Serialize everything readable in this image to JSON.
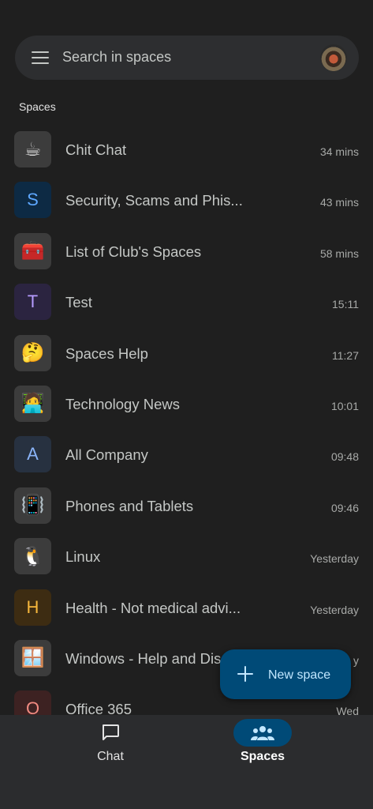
{
  "search": {
    "placeholder": "Search in spaces"
  },
  "section_label": "Spaces",
  "spaces": [
    {
      "title": "Chit Chat",
      "time": "34 mins",
      "icon_type": "emoji",
      "icon": "☕",
      "icon_name": "coffee-icon"
    },
    {
      "title": "Security, Scams and Phis...",
      "time": "43 mins",
      "icon_type": "letter",
      "icon": "S",
      "bg": "#0d2a44",
      "fg": "#5ea8ff"
    },
    {
      "title": "List of Club's Spaces",
      "time": "58 mins",
      "icon_type": "emoji",
      "icon": "🧰",
      "icon_name": "toolbox-icon"
    },
    {
      "title": "Test",
      "time": "15:11",
      "icon_type": "letter",
      "icon": "T",
      "bg": "#2b2440",
      "fg": "#b69cff"
    },
    {
      "title": "Spaces Help",
      "time": "11:27",
      "icon_type": "emoji",
      "icon": "🤔",
      "icon_name": "thinking-face-icon"
    },
    {
      "title": "Technology News",
      "time": "10:01",
      "icon_type": "emoji",
      "icon": "🧑‍💻",
      "icon_name": "technologist-icon"
    },
    {
      "title": "All Company",
      "time": "09:48",
      "icon_type": "letter",
      "icon": "A",
      "bg": "#273140",
      "fg": "#8ab4f8"
    },
    {
      "title": "Phones and Tablets",
      "time": "09:46",
      "icon_type": "emoji",
      "icon": "📳",
      "icon_name": "vibrating-phone-icon"
    },
    {
      "title": "Linux",
      "time": "Yesterday",
      "icon_type": "emoji",
      "icon": "🐧",
      "icon_name": "penguin-icon"
    },
    {
      "title": "Health - Not medical advi...",
      "time": "Yesterday",
      "icon_type": "letter",
      "icon": "H",
      "bg": "#3d2c12",
      "fg": "#f6b73c"
    },
    {
      "title": "Windows - Help and Dis",
      "time": "y",
      "icon_type": "emoji",
      "icon": "🪟",
      "icon_name": "window-icon"
    },
    {
      "title": "Office 365",
      "time": "Wed",
      "icon_type": "letter",
      "icon": "O",
      "bg": "#3d2222",
      "fg": "#f28b82"
    }
  ],
  "fab": {
    "label": "New space"
  },
  "bottom_nav": {
    "chat_label": "Chat",
    "spaces_label": "Spaces",
    "active": "spaces"
  }
}
